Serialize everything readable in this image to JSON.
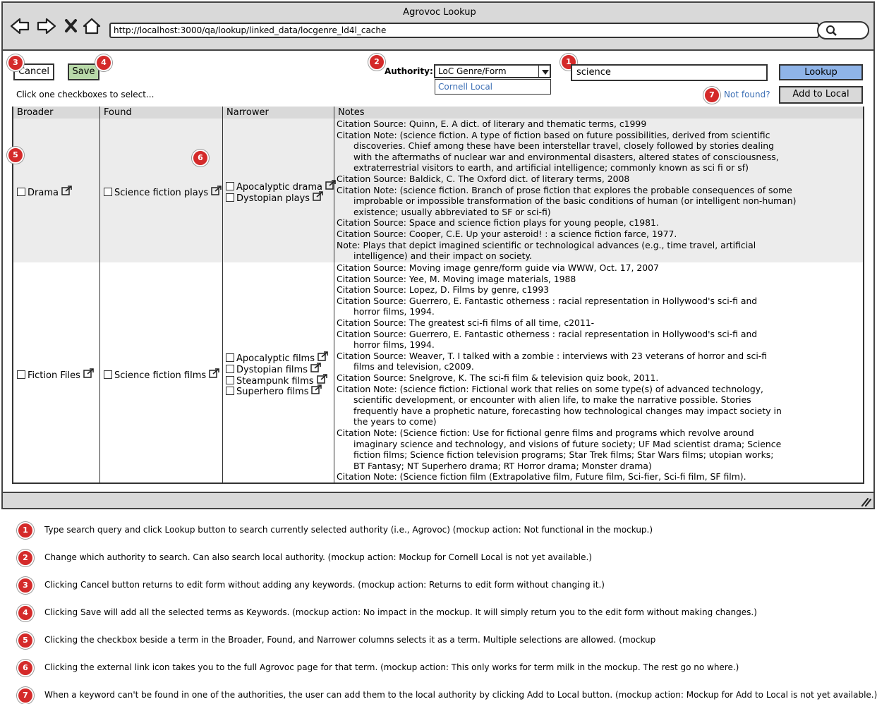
{
  "window": {
    "title": "Agrovoc Lookup",
    "url": "http://localhost:3000/qa/lookup/linked_data/locgenre_ld4l_cache"
  },
  "nav_icons": [
    "back-icon",
    "forward-icon",
    "close-icon",
    "home-icon"
  ],
  "toolbar": {
    "cancel_label": "Cancel",
    "save_label": "Save",
    "authority_label": "Authority:",
    "authority_selected": "LoC Genre/Form",
    "authority_option_2": "Cornell Local",
    "search_value": "science",
    "lookup_label": "Lookup",
    "instructions": "Click one checkboxes to select...",
    "not_found": "Not found?",
    "add_local_label": "Add to Local"
  },
  "badges": {
    "b1": "1",
    "b2": "2",
    "b3": "3",
    "b4": "4",
    "b5": "5",
    "b6": "6",
    "b7": "7"
  },
  "table": {
    "headers": {
      "broader": "Broader",
      "found": "Found",
      "narrower": "Narrower",
      "notes": "Notes"
    },
    "rows": [
      {
        "broader": "Drama",
        "found": "Science fiction plays",
        "narrower": [
          "Apocalyptic drama",
          "Dystopian plays"
        ],
        "notes": [
          {
            "text": "Citation Source: Quinn, E. A dict. of literary and thematic terms, c1999",
            "indent": false
          },
          {
            "text": "Citation Note: (science fiction. A type of fiction based on future possibilities, derived from scientific",
            "indent": false
          },
          {
            "text": "discoveries. Chief among these have been interstellar travel, closely followed by stories dealing",
            "indent": true
          },
          {
            "text": "with the aftermaths of nuclear war and environmental disasters, altered states of consciousness,",
            "indent": true
          },
          {
            "text": "extraterrestrial visitors to earth, and artificial intelligence; commonly known as sci fi or sf)",
            "indent": true
          },
          {
            "text": "Citation Source: Baldick, C. The Oxford dict. of literary terms, 2008",
            "indent": false
          },
          {
            "text": "Citation Note: (science fiction. Branch of prose fiction that explores the probable consequences of some",
            "indent": false
          },
          {
            "text": "improbable or impossible transformation of the basic conditions of human (or intelligent non-human)",
            "indent": true
          },
          {
            "text": "existence; usually abbreviated to SF or sci-fi)",
            "indent": true
          },
          {
            "text": "Citation Source: Space and science fiction plays for young people, c1981.",
            "indent": false
          },
          {
            "text": "Citation Source: Cooper, C.E. Up your asteroid! : a science fiction farce, 1977.",
            "indent": false
          },
          {
            "text": "Note:  Plays that depict imagined scientific or technological advances (e.g., time travel, artificial",
            "indent": false
          },
          {
            "text": "intelligence) and their impact on society.",
            "indent": true
          }
        ]
      },
      {
        "broader": "Fiction Files",
        "found": "Science fiction films",
        "narrower": [
          "Apocalyptic films",
          "Dystopian films",
          "Steampunk films",
          "Superhero films"
        ],
        "notes": [
          {
            "text": "Citation Source: Moving image genre/form guide via WWW, Oct. 17, 2007",
            "indent": false
          },
          {
            "text": "Citation Source: Yee, M. Moving image materials, 1988",
            "indent": false
          },
          {
            "text": "Citation Source: Lopez, D. Films by genre, c1993",
            "indent": false
          },
          {
            "text": "Citation Source: Guerrero, E. Fantastic otherness : racial representation in Hollywood's sci-fi and",
            "indent": false
          },
          {
            "text": "horror films, 1994.",
            "indent": true
          },
          {
            "text": "Citation Source: The greatest sci-fi films of all time, c2011-",
            "indent": false
          },
          {
            "text": "Citation Source: Guerrero, E. Fantastic otherness : racial representation in Hollywood's sci-fi and",
            "indent": false
          },
          {
            "text": "horror films, 1994.",
            "indent": true
          },
          {
            "text": "Citation Source: Weaver, T. I talked with a zombie : interviews with 23 veterans of horror and sci-fi",
            "indent": false
          },
          {
            "text": "films and television, c2009.",
            "indent": true
          },
          {
            "text": "Citation Source: Snelgrove, K. The sci-fi film & television quiz book, 2011.",
            "indent": false
          },
          {
            "text": "Citation Note: (science fiction: Fictional work that relies on some type(s) of advanced technology,",
            "indent": false
          },
          {
            "text": "scientific development, or encounter with alien life, to make the narrative possible. Stories",
            "indent": true
          },
          {
            "text": "frequently have a prophetic nature, forecasting how technological changes may impact society in",
            "indent": true
          },
          {
            "text": "the years to come)",
            "indent": true
          },
          {
            "text": "Citation Note: (Science fiction: Use for fictional genre films and programs which revolve around",
            "indent": false
          },
          {
            "text": "imaginary science and technology, and visions of future society; UF Mad scientist drama; Science",
            "indent": true
          },
          {
            "text": "fiction films; Science fiction television programs; Star Trek films; Star Wars films; utopian works;",
            "indent": true
          },
          {
            "text": "BT Fantasy; NT Superhero drama; RT Horror drama; Monster drama)",
            "indent": true
          },
          {
            "text": "Citation Note: (Science fiction film (Extrapolative film, Future film, Sci-fier, Sci-fi film, SF film).",
            "indent": false
          }
        ]
      }
    ]
  },
  "legend": [
    {
      "num": "1",
      "text": "Type search query and click Lookup button to search currently selected authority (i.e., Agrovoc)  (mockup action: Not functional in the mockup.)"
    },
    {
      "num": "2",
      "text": "Change which authority to search.  Can also search local authority.  (mockup action: Mockup for Cornell Local is not yet available.)"
    },
    {
      "num": "3",
      "text": "Clicking Cancel button returns to edit form without adding any keywords.  (mockup action: Returns to edit form without changing it.)"
    },
    {
      "num": "4",
      "text": "Clicking Save will add all the selected terms as Keywords.  (mockup action: No impact in the mockup.  It will simply return you to the edit form without making changes.)"
    },
    {
      "num": "5",
      "text": "Clicking the checkbox beside a term in the Broader, Found, and Narrower columns selects it as a term.  Multiple selections are allowed.  (mockup"
    },
    {
      "num": "6",
      "text": "Clicking the external link icon takes you to the full Agrovoc page for that term.  (mockup action: This only works for term milk in the mockup.  The rest go no where.)"
    },
    {
      "num": "7",
      "text": "When a keyword can't be found in one of the authorities, the user can add them to the local authority by clicking Add to Local button. (mockup action: Mockup for Add to Local is not yet available.)"
    }
  ],
  "colors": {
    "badge": "#d42a2a",
    "lookup_button": "#8fb4e8",
    "save_button": "#b8d9a8",
    "link": "#3c6fb5",
    "chrome": "#d9d9d9",
    "row_shade": "#ececec"
  }
}
